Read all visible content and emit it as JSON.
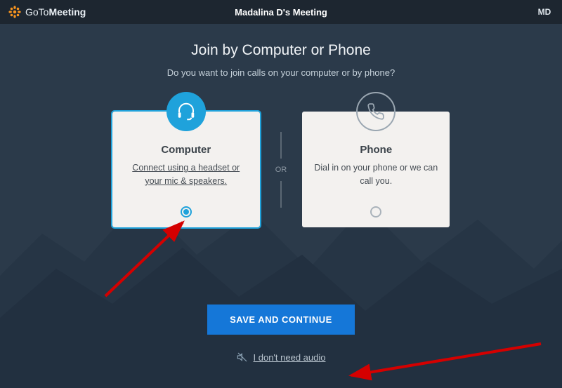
{
  "header": {
    "product_prefix": "GoTo",
    "product_bold": "Meeting",
    "meeting_title": "Madalina D's Meeting",
    "user_initials": "MD"
  },
  "title": "Join by Computer or Phone",
  "subtitle": "Do you want to join calls on your computer or by phone?",
  "divider_label": "OR",
  "options": {
    "computer": {
      "title": "Computer",
      "description": "Connect using a headset or your mic & speakers.",
      "selected": true
    },
    "phone": {
      "title": "Phone",
      "description": "Dial in on your phone or we can call you.",
      "selected": false
    }
  },
  "save_button_label": "SAVE AND CONTINUE",
  "no_audio_label": "I don't need audio",
  "colors": {
    "accent": "#1fa2db",
    "primary_button": "#1577d8",
    "header_bg": "#1d2630",
    "body_bg": "#2b3a4a"
  }
}
